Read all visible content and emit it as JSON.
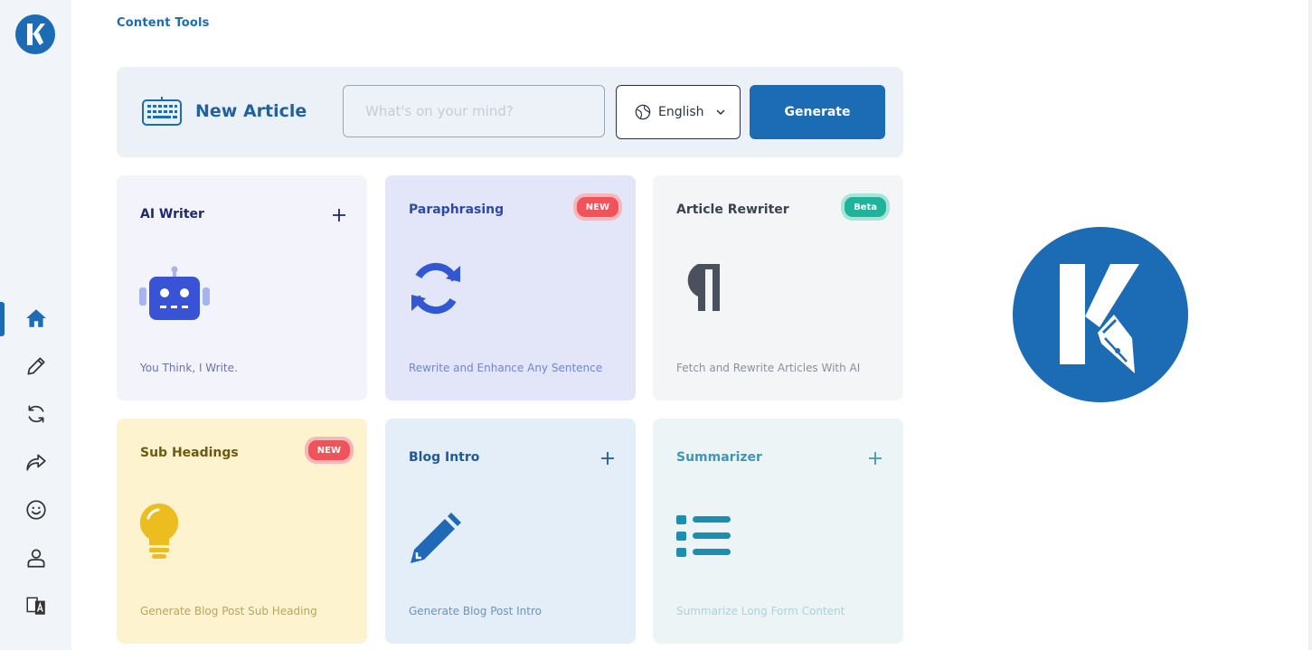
{
  "breadcrumb": "Content Tools",
  "composer": {
    "title": "New Article",
    "placeholder": "What's on your mind?",
    "language": "English",
    "generate_label": "Generate"
  },
  "cards": [
    {
      "title": "AI Writer",
      "desc": "You Think, I Write.",
      "badge": null,
      "icon": "robot-icon"
    },
    {
      "title": "Paraphrasing",
      "desc": "Rewrite and Enhance Any Sentence",
      "badge": "NEW",
      "icon": "sync-icon"
    },
    {
      "title": "Article Rewriter",
      "desc": "Fetch and Rewrite Articles With AI",
      "badge": "Beta",
      "icon": "paragraph-icon"
    },
    {
      "title": "Sub Headings",
      "desc": "Generate Blog Post Sub Heading",
      "badge": "NEW",
      "icon": "lightbulb-icon"
    },
    {
      "title": "Blog Intro",
      "desc": "Generate Blog Post Intro",
      "badge": null,
      "icon": "pencil-icon"
    },
    {
      "title": "Summarizer",
      "desc": "Summarize Long Form Content",
      "badge": null,
      "icon": "list-icon"
    }
  ],
  "sidebar": {
    "active": "home",
    "items": [
      "home-icon",
      "edit-icon",
      "refresh-icon",
      "share-icon",
      "smiley-icon",
      "user-icon",
      "translate-icon"
    ]
  },
  "colors": {
    "brand": "#1c6bb5",
    "new_badge": "#f0535a",
    "beta_badge": "#1fb39c"
  }
}
